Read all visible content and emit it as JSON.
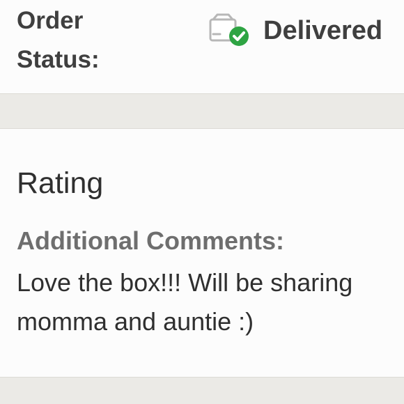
{
  "order_status": {
    "label_line1": "Order",
    "label_line2": "Status:",
    "value": "Delivered",
    "icon": "package-delivered-icon",
    "check_color": "#2ea443"
  },
  "rating_section": {
    "title": "Rating",
    "comments_label": "Additional Comments:",
    "comments_line1": "Love the box!!! Will be sharing",
    "comments_line2": "momma and auntie :)"
  }
}
